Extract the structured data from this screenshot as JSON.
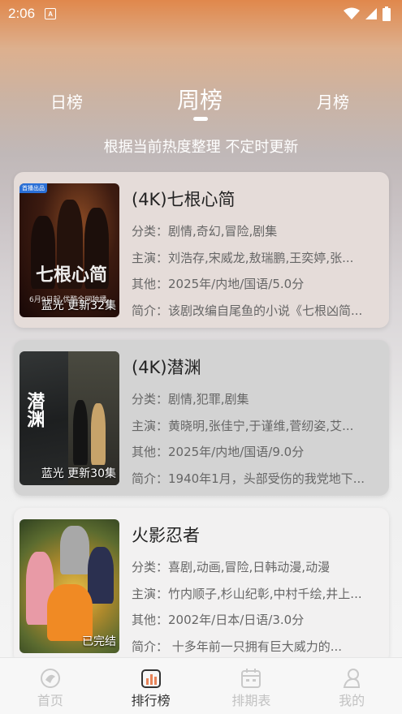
{
  "status_bar": {
    "time": "2:06",
    "app_icon_letter": "A"
  },
  "tabs": [
    {
      "label": "日榜",
      "active": false
    },
    {
      "label": "周榜",
      "active": true
    },
    {
      "label": "月榜",
      "active": false
    }
  ],
  "subtitle": "根据当前热度整理 不定时更新",
  "items": [
    {
      "title": "(4K)七根心简",
      "genre": "分类：剧情,奇幻,冒险,剧集",
      "cast": "主演：刘浩存,宋威龙,敖瑞鹏,王奕婷,张...",
      "other": "其他：2025年/内地/国语/5.0分",
      "intro": "简介：该剧改编自尾鱼的小说《七根凶简...",
      "badge": "蓝光 更新32集",
      "poster_tag": "首播出品",
      "poster_art": "七根心简",
      "poster_sub": "6月9日起 优酷全网独播"
    },
    {
      "title": "(4K)潜渊",
      "genre": "分类：剧情,犯罪,剧集",
      "cast": "主演：黄晓明,张佳宁,于谨维,菅纫姿,艾...",
      "other": "其他：2025年/内地/国语/9.0分",
      "intro": "简介：1940年1月，头部受伤的我党地下...",
      "badge": "蓝光 更新30集",
      "poster_art": "潜渊"
    },
    {
      "title": "火影忍者",
      "genre": "分类：喜剧,动画,冒险,日韩动漫,动漫",
      "cast": "主演：竹内顺子,杉山纪彰,中村千绘,井上...",
      "other": "其他：2002年/日本/日语/3.0分",
      "intro": "简介：    十多年前一只拥有巨大威力的...",
      "badge": "已完结"
    }
  ],
  "nav": [
    {
      "label": "首页",
      "icon": "home-icon",
      "active": false
    },
    {
      "label": "排行榜",
      "icon": "ranking-icon",
      "active": true
    },
    {
      "label": "排期表",
      "icon": "calendar-icon",
      "active": false
    },
    {
      "label": "我的",
      "icon": "profile-icon",
      "active": false
    }
  ],
  "colors": {
    "active_text": "#333333",
    "inactive_text": "#c2c2c2",
    "tab_text": "#ffffff"
  }
}
